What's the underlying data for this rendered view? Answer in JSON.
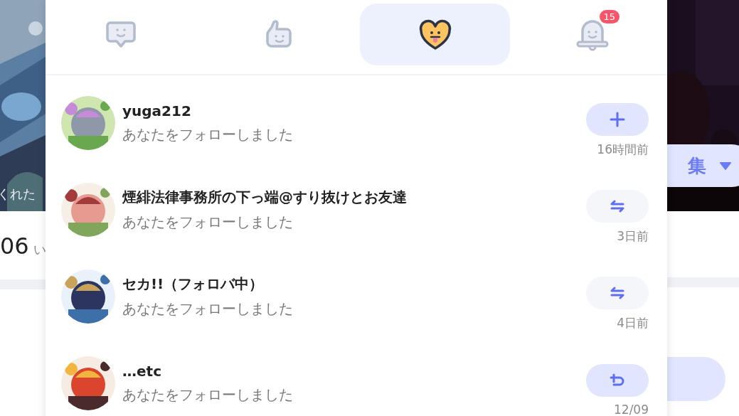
{
  "background": {
    "left_caption": "くれた",
    "left_count": "06",
    "left_unit": "い",
    "edit_button": "集"
  },
  "tabs": [
    {
      "kind": "comment",
      "selected": false
    },
    {
      "kind": "like",
      "selected": false
    },
    {
      "kind": "follow",
      "selected": true
    },
    {
      "kind": "bell",
      "selected": false,
      "badge": "15"
    }
  ],
  "notifications": [
    {
      "name": "yuga212",
      "message": "あなたをフォローしました",
      "time": "16時間前",
      "action": {
        "kind": "follow"
      }
    },
    {
      "name": "煙緋法律事務所の下っ端@すり抜けとお友達",
      "message": "あなたをフォローしました",
      "time": "3日前",
      "action": {
        "kind": "mutual"
      }
    },
    {
      "name": "セカ!!（フォロバ中）",
      "message": "あなたをフォローしました",
      "time": "4日前",
      "action": {
        "kind": "mutual"
      }
    },
    {
      "name": "…etc",
      "message": "あなたをフォローしました",
      "time": "12/09",
      "action": {
        "kind": "followback"
      }
    }
  ]
}
